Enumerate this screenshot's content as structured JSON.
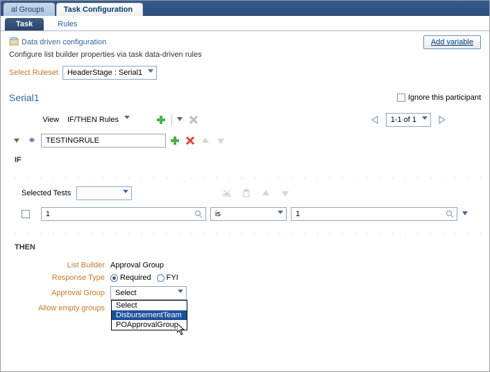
{
  "topTabs": {
    "groups": "al Groups",
    "taskConfig": "Task Configuration"
  },
  "subTabs": {
    "task": "Task",
    "rules": "Rules"
  },
  "header": {
    "title": "Data driven configuration",
    "hint": "Configure list builder properties via task data-driven rules",
    "addVariable": "Add variable"
  },
  "ruleset": {
    "label": "Select Ruleset",
    "value": "HeaderStage : Serial1"
  },
  "serial": {
    "title": "Serial1",
    "ignore": "Ignore this participant",
    "viewLabel": "View",
    "viewValue": "IF/THEN Rules",
    "pager": "1-1 of 1"
  },
  "rule": {
    "name": "TESTINGRULE"
  },
  "if": {
    "label": "IF",
    "selectedTests": "Selected Tests",
    "left": "1",
    "op": "is",
    "right": "1"
  },
  "then": {
    "label": "THEN",
    "listBuilderLabel": "List Builder",
    "listBuilderValue": "Approval Group",
    "responseTypeLabel": "Response Type",
    "required": "Required",
    "fyi": "FYI",
    "approvalGroupLabel": "Approval Group",
    "approvalGroupValue": "Select",
    "allowEmptyLabel": "Allow empty groups",
    "options": {
      "o0": "Select",
      "o1": "DisbursementTeam",
      "o2": "POApprovalGroup"
    }
  }
}
